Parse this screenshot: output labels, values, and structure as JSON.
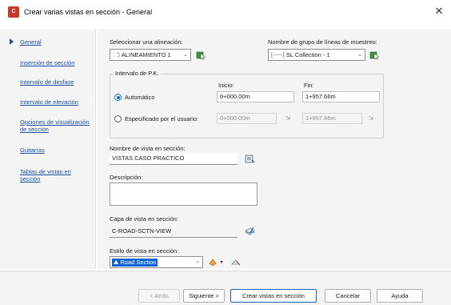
{
  "window": {
    "title": "Crear varias vistas en sección - General",
    "icon": "civil3d-app-icon"
  },
  "sidebar": {
    "items": [
      {
        "label": "General",
        "active": true
      },
      {
        "label": "Inserción de sección",
        "active": false
      },
      {
        "label": "Intervalo de desfase",
        "active": false
      },
      {
        "label": "Intervalo de elevación",
        "active": false
      },
      {
        "label": "Opciones de visualización de sección",
        "active": false
      },
      {
        "label": "Guitarras",
        "active": false
      },
      {
        "label": "Tablas de vistas en sección",
        "active": false
      }
    ]
  },
  "general": {
    "alignment_label": "Seleccionar una alineación:",
    "alignment_value": "ALINEAMIENTO 1",
    "sample_group_label": "Nombre de grupo de líneas de muestreo:",
    "sample_group_value": "SL Collection - 1",
    "station_range": {
      "title": "Intervalo de P.K.",
      "start_label": "Inicio:",
      "end_label": "Fin:",
      "automatic_label": "Automático",
      "automatic_start": "0+000.00m",
      "automatic_end": "1+957.66m",
      "user_label": "Especificado por el usuario:",
      "user_start": "0+000.00m",
      "user_end": "1+957.66m",
      "selected": "automatic"
    },
    "view_name_label": "Nombre de vista en sección:",
    "view_name_value": "VISTAS CASO PRACTICO",
    "description_label": "Descripción:",
    "description_value": "",
    "layer_label": "Capa de vista en sección:",
    "layer_value": "C-ROAD-SCTN-VIEW",
    "style_label": "Estilo de vista en sección:",
    "style_value": "Road Section"
  },
  "footer": {
    "back": "< Atrás",
    "next": "Siguiente >",
    "create": "Crear vistas en sección",
    "cancel": "Cancelar",
    "help": "Ayuda"
  }
}
